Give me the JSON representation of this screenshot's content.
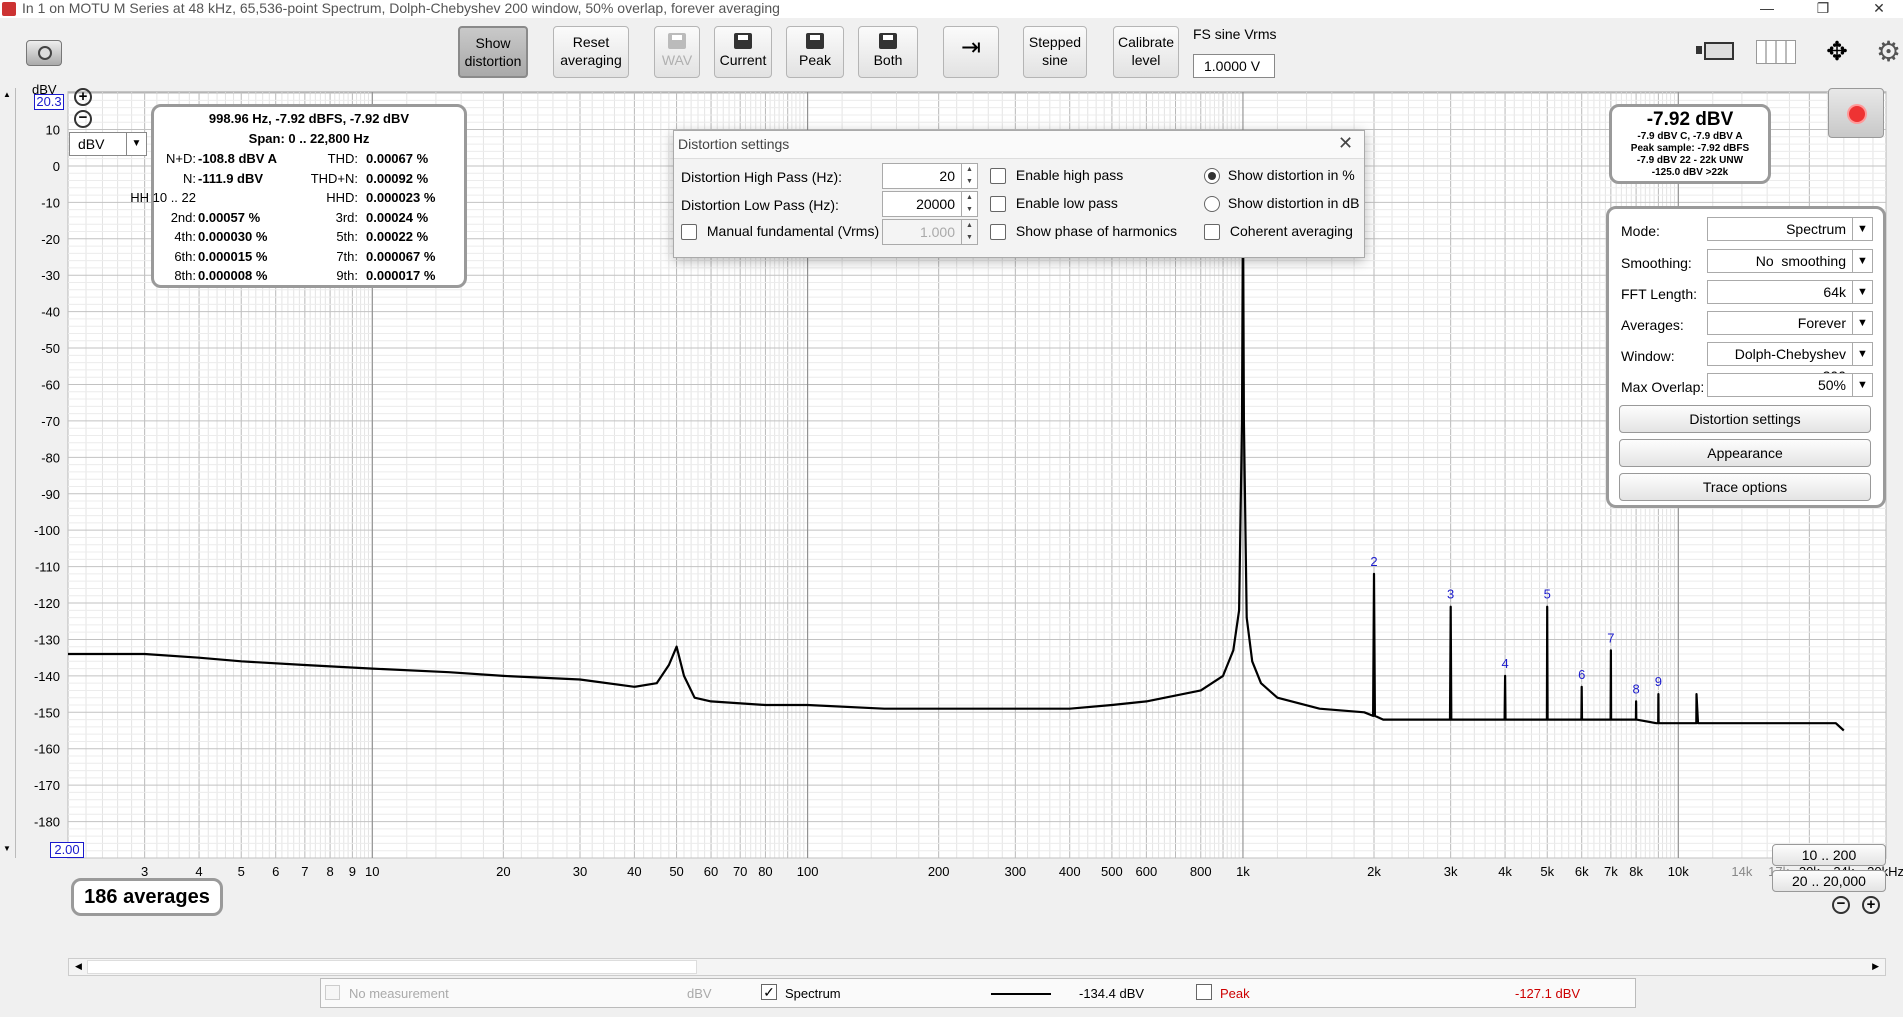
{
  "title_bar": {
    "title": "In 1 on MOTU M Series at 48 kHz, 65,536-point Spectrum, Dolph-Chebyshev 200 window, 50% overlap, forever averaging"
  },
  "toolbar": {
    "show_distortion": [
      "Show",
      "distortion"
    ],
    "reset_averaging": [
      "Reset",
      "averaging"
    ],
    "wav": "WAV",
    "current": "Current",
    "peak": "Peak",
    "both": "Both",
    "stepped_sine": [
      "Stepped",
      "sine"
    ],
    "calibrate_level": [
      "Calibrate",
      "level"
    ],
    "fs_sine_label": "FS sine Vrms",
    "fs_sine_value": "1.0000 V"
  },
  "axis": {
    "unit": "dBV",
    "y_top_value": "20.3",
    "x_left_value": "2.00",
    "unit_selector": "dBV",
    "y_ticks": [
      "10",
      "0",
      "-10",
      "-20",
      "-30",
      "-40",
      "-50",
      "-60",
      "-70",
      "-80",
      "-90",
      "-100",
      "-110",
      "-120",
      "-130",
      "-140",
      "-150",
      "-160",
      "-170",
      "-180"
    ],
    "x_ticks": [
      "3",
      "4",
      "5",
      "6",
      "7",
      "8",
      "9",
      "10",
      "20",
      "30",
      "40",
      "50",
      "60",
      "70",
      "80",
      "100",
      "200",
      "300",
      "400",
      "500",
      "600",
      "800",
      "1k",
      "2k",
      "3k",
      "4k",
      "5k",
      "6k",
      "7k",
      "8k",
      "10k",
      "14k",
      "17k",
      "20k",
      "24k",
      "30kHz"
    ]
  },
  "readout": {
    "header": "998.96 Hz, -7.92 dBFS, -7.92 dBV",
    "span": "Span: 0 .. 22,800 Hz",
    "rows": [
      {
        "l_label": "N+D:",
        "l_value": "-108.8 dBV A",
        "r_label": "THD:",
        "r_value": "0.00067 %"
      },
      {
        "l_label": "N:",
        "l_value": "-111.9 dBV",
        "r_label": "THD+N:",
        "r_value": "0.00092 %"
      },
      {
        "l_label": "HH 10 .. 22",
        "l_value": "",
        "r_label": "HHD:",
        "r_value": "0.000023 %"
      },
      {
        "l_label": "2nd:",
        "l_value": "0.00057 %",
        "r_label": "3rd:",
        "r_value": "0.00024 %"
      },
      {
        "l_label": "4th:",
        "l_value": "0.000030 %",
        "r_label": "5th:",
        "r_value": "0.00022 %"
      },
      {
        "l_label": "6th:",
        "l_value": "0.000015 %",
        "r_label": "7th:",
        "r_value": "0.000067 %"
      },
      {
        "l_label": "8th:",
        "l_value": "0.000008 %",
        "r_label": "9th:",
        "r_value": "0.000017 %"
      }
    ]
  },
  "distortion_settings": {
    "title": "Distortion settings",
    "hp_label": "Distortion High Pass (Hz):",
    "hp_value": "20",
    "lp_label": "Distortion Low Pass (Hz):",
    "lp_value": "20000",
    "manual_fund_label": "Manual fundamental (Vrms)",
    "manual_fund_value": "1.000",
    "enable_hp": "Enable high pass",
    "enable_lp": "Enable low pass",
    "show_phase": "Show phase of harmonics",
    "show_pct": "Show distortion in %",
    "show_db": "Show distortion in dB",
    "coherent": "Coherent averaging"
  },
  "level_panel": {
    "main": "-7.92 dBV",
    "lines": [
      "-7.9 dBV C, -7.9 dBV A",
      "Peak sample: -7.92 dBFS",
      "-7.9 dBV 22 - 22k UNW",
      "-125.0 dBV >22k"
    ]
  },
  "controls": {
    "mode_label": "Mode:",
    "mode_value": "Spectrum",
    "smoothing_label": "Smoothing:",
    "smoothing_value": "No  smoothing",
    "fft_label": "FFT Length:",
    "fft_value": "64k",
    "averages_label": "Averages:",
    "averages_value": "Forever",
    "window_label": "Window:",
    "window_value": "Dolph-Chebyshev 200",
    "overlap_label": "Max Overlap:",
    "overlap_value": "50%",
    "distortion_settings_btn": "Distortion settings",
    "appearance_btn": "Appearance",
    "trace_options_btn": "Trace options"
  },
  "averages_badge": "186 averages",
  "range_buttons": {
    "r1": "10 .. 200",
    "r2": "20 .. 20,000"
  },
  "harmonic_labels": [
    "2",
    "3",
    "4",
    "5",
    "6",
    "7",
    "8",
    "9"
  ],
  "status": {
    "no_measurement": "No measurement",
    "no_meas_unit": "dBV",
    "spectrum": "Spectrum",
    "spectrum_value": "-134.4 dBV",
    "peak": "Peak",
    "peak_value": "-127.1 dBV"
  },
  "chart_data": {
    "type": "line",
    "x_scale": "log",
    "xlim": [
      2,
      30000
    ],
    "ylim": [
      -190,
      20.3
    ],
    "ylabel": "dBV",
    "grid": true,
    "series": [
      {
        "name": "Spectrum",
        "x": [
          2,
          3,
          4,
          5,
          7,
          10,
          15,
          20,
          30,
          40,
          45,
          48,
          50,
          52,
          55,
          60,
          80,
          100,
          150,
          200,
          300,
          400,
          500,
          600,
          800,
          900,
          950,
          980,
          995,
          1000,
          1005,
          1020,
          1050,
          1100,
          1200,
          1500,
          1900,
          1990,
          2000,
          2010,
          2100,
          2900,
          2990,
          3000,
          3010,
          3900,
          3990,
          4000,
          4010,
          4900,
          4990,
          5000,
          5010,
          5900,
          5990,
          6000,
          6010,
          6900,
          6990,
          7000,
          7010,
          7900,
          7990,
          8000,
          8010,
          8900,
          8990,
          9000,
          9010,
          10000,
          11000,
          11010,
          11100,
          13000,
          16000,
          20000,
          23000,
          24000
        ],
        "y": [
          -134,
          -134,
          -135,
          -136,
          -137,
          -138,
          -139,
          -140,
          -141,
          -143,
          -142,
          -137,
          -132,
          -140,
          -146,
          -147,
          -148,
          -148,
          -149,
          -149,
          -149,
          -149,
          -148,
          -147,
          -144,
          -140,
          -133,
          -122,
          -70,
          -7.92,
          -70,
          -124,
          -136,
          -142,
          -146,
          -149,
          -150,
          -151,
          -112,
          -151,
          -152,
          -152,
          -152,
          -121,
          -152,
          -152,
          -152,
          -140,
          -152,
          -152,
          -152,
          -121,
          -152,
          -152,
          -152,
          -143,
          -152,
          -152,
          -152,
          -133,
          -152,
          -152,
          -152,
          -147,
          -152,
          -153,
          -153,
          -145,
          -153,
          -153,
          -153,
          -145,
          -153,
          -153,
          -153,
          -153,
          -153,
          -155
        ]
      }
    ],
    "harmonics": [
      {
        "label": "2",
        "x": 2000,
        "y": -112
      },
      {
        "label": "3",
        "x": 3000,
        "y": -121
      },
      {
        "label": "4",
        "x": 4000,
        "y": -140
      },
      {
        "label": "5",
        "x": 5000,
        "y": -121
      },
      {
        "label": "6",
        "x": 6000,
        "y": -143
      },
      {
        "label": "7",
        "x": 7000,
        "y": -133
      },
      {
        "label": "8",
        "x": 8000,
        "y": -147
      },
      {
        "label": "9",
        "x": 9000,
        "y": -145
      }
    ]
  },
  "colors": {
    "accent": "#1a1acc",
    "peak": "#cc0000",
    "plot_bg": "#ffffff",
    "grid": "#c8c8c8"
  }
}
